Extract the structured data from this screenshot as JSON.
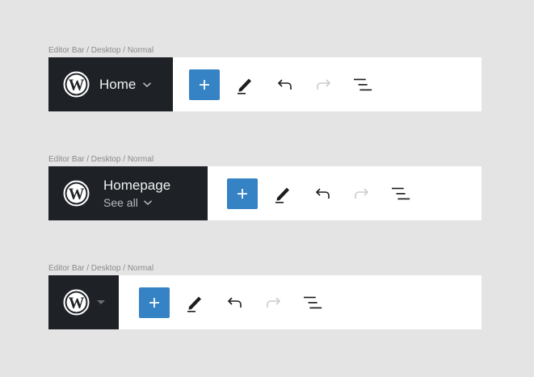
{
  "bars": [
    {
      "frame_label": "Editor Bar / Desktop / Normal",
      "site_title": "Home"
    },
    {
      "frame_label": "Editor Bar / Desktop / Normal",
      "site_title": "Homepage",
      "site_subtitle": "See all"
    },
    {
      "frame_label": "Editor Bar / Desktop / Normal"
    }
  ],
  "icons": {
    "logo": "wordpress-logo-icon",
    "add": "plus-icon",
    "edit": "pencil-icon",
    "undo": "undo-icon",
    "redo": "redo-icon",
    "outline": "list-view-icon",
    "dropdown": "chevron-down-icon"
  },
  "colors": {
    "dark_block": "#1e2227",
    "accent": "#3582c4",
    "icon": "#1e1e1e",
    "icon_disabled": "#cccccc",
    "background": "#e4e4e4"
  }
}
